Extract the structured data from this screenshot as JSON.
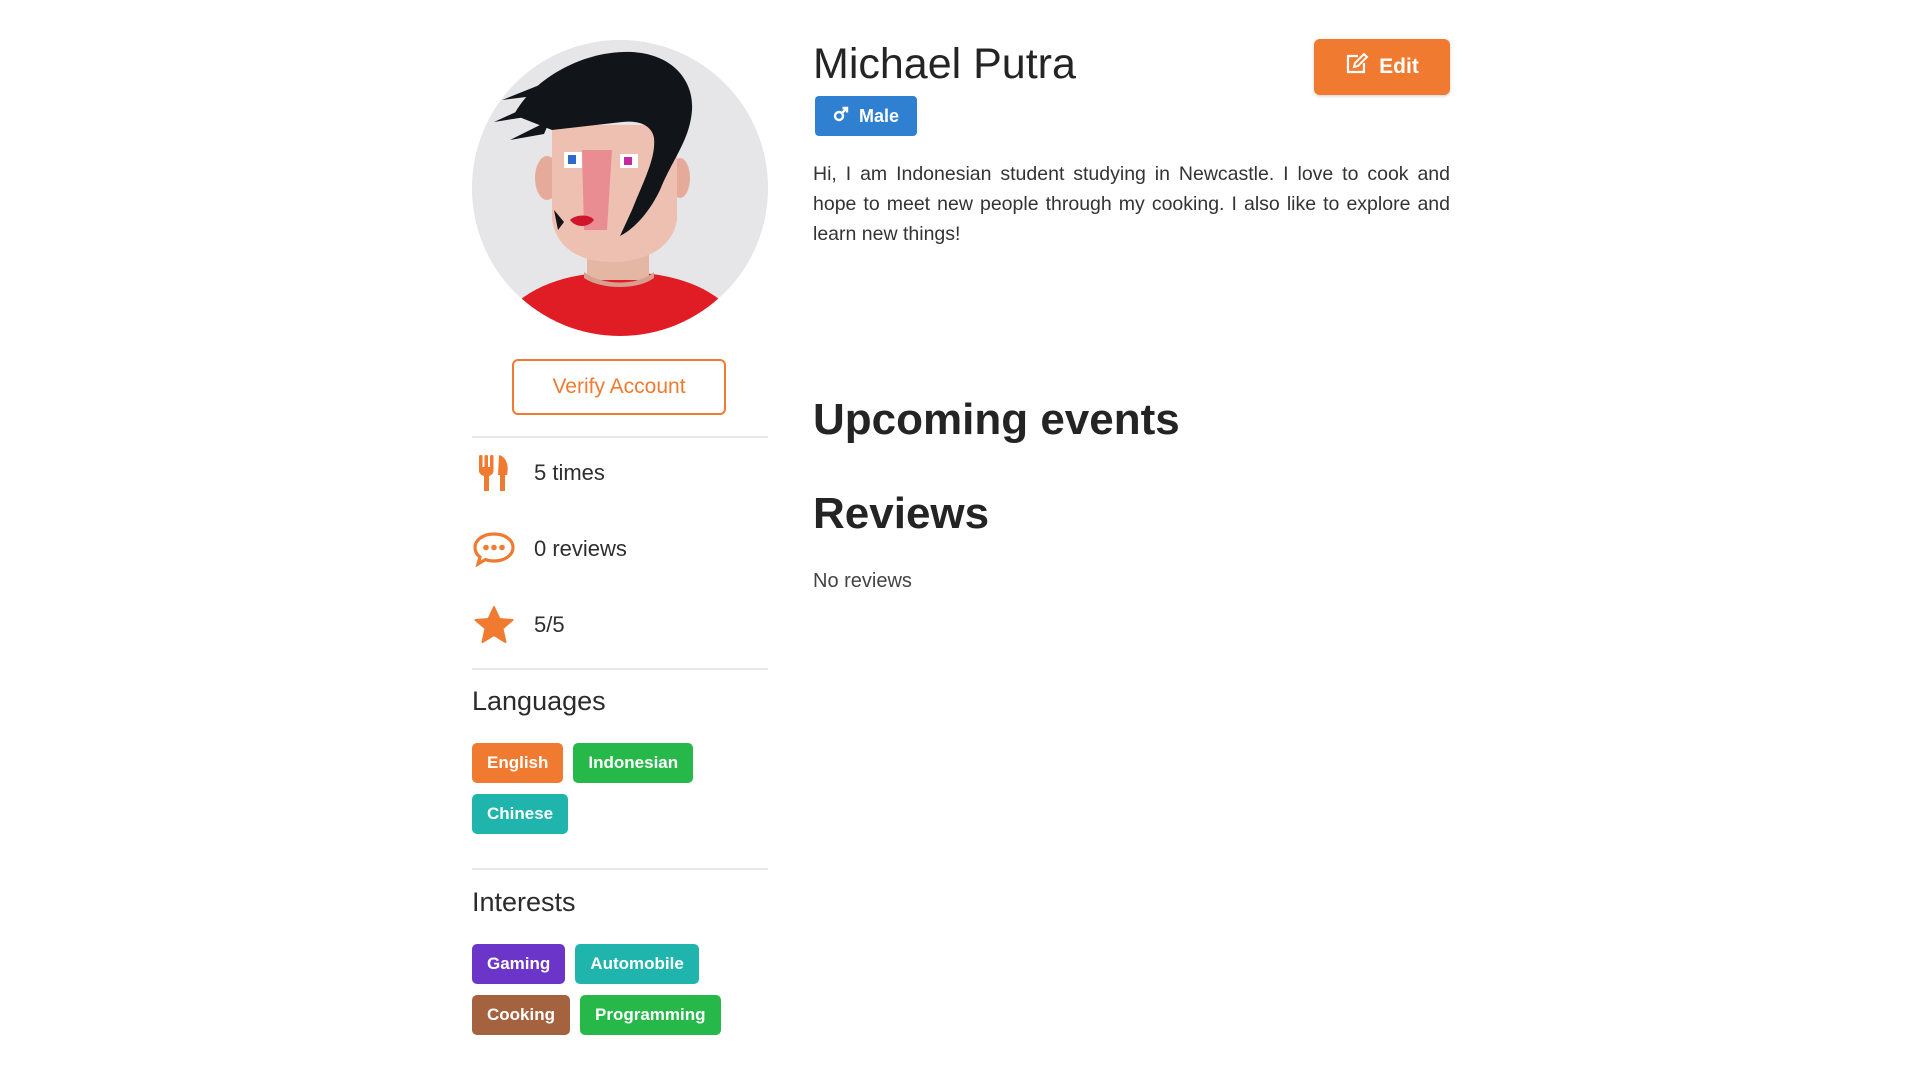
{
  "profile": {
    "name": "Michael Putra",
    "gender": "Male",
    "bio": "Hi, I am Indonesian student studying in Newcastle. I love to cook and hope to meet new people through my cooking. I also like to explore and learn new things!",
    "edit_label": "Edit",
    "verify_label": "Verify Account"
  },
  "stats": [
    {
      "icon": "utensils-icon",
      "text": "5 times"
    },
    {
      "icon": "comments-icon",
      "text": "0 reviews"
    },
    {
      "icon": "star-icon",
      "text": "5/5"
    }
  ],
  "languages": {
    "title": "Languages",
    "items": [
      {
        "label": "English",
        "color": "#f07a30"
      },
      {
        "label": "Indonesian",
        "color": "#27b84a"
      },
      {
        "label": "Chinese",
        "color": "#1fb5ad"
      }
    ]
  },
  "interests": {
    "title": "Interests",
    "items": [
      {
        "label": "Gaming",
        "color": "#6a35c8"
      },
      {
        "label": "Automobile",
        "color": "#1fb5ad"
      },
      {
        "label": "Cooking",
        "color": "#a5623f"
      },
      {
        "label": "Programming",
        "color": "#27b84a"
      }
    ]
  },
  "sections": {
    "upcoming_events": "Upcoming events",
    "reviews": "Reviews",
    "no_reviews": "No reviews"
  },
  "colors": {
    "accent": "#f07a30",
    "badge_blue": "#2f80d0"
  }
}
